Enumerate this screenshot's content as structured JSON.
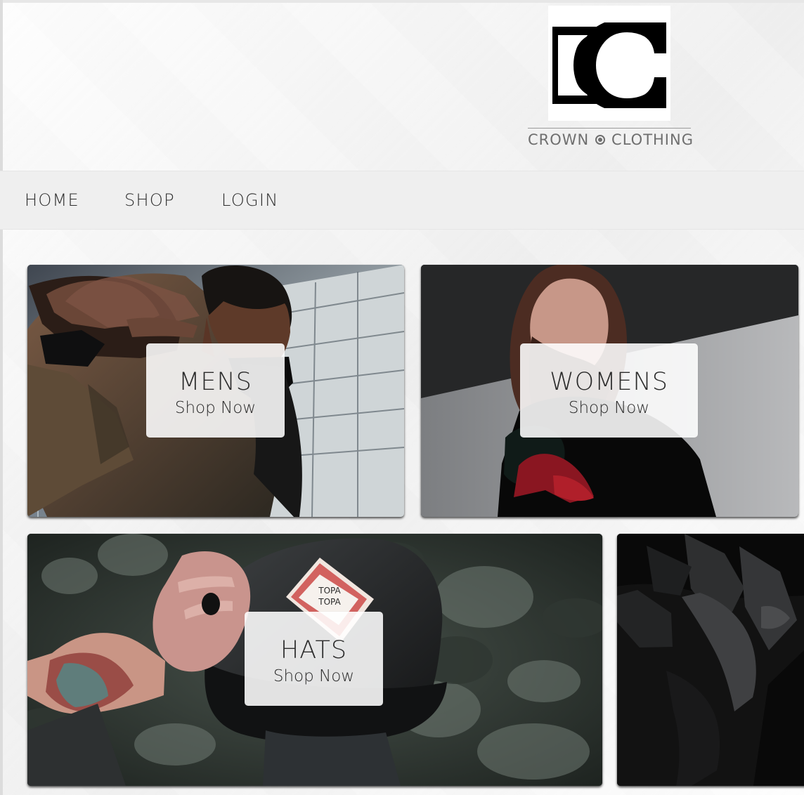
{
  "brand": {
    "name_left": "CROWN",
    "name_right": "CLOTHING",
    "logo_icon": "cc-monogram-icon",
    "separator_icon": "circle-dot-icon"
  },
  "nav": {
    "items": [
      {
        "label": "HOME"
      },
      {
        "label": "SHOP"
      },
      {
        "label": "LOGIN"
      }
    ]
  },
  "categories": [
    {
      "title": "MENS",
      "cta": "Shop Now"
    },
    {
      "title": "WOMENS",
      "cta": "Shop Now"
    },
    {
      "title": "HATS",
      "cta": "Shop Now"
    }
  ],
  "colors": {
    "text": "#2c2c2c",
    "nav_background": "#efefef",
    "overlay_background": "#ffffffe0"
  }
}
